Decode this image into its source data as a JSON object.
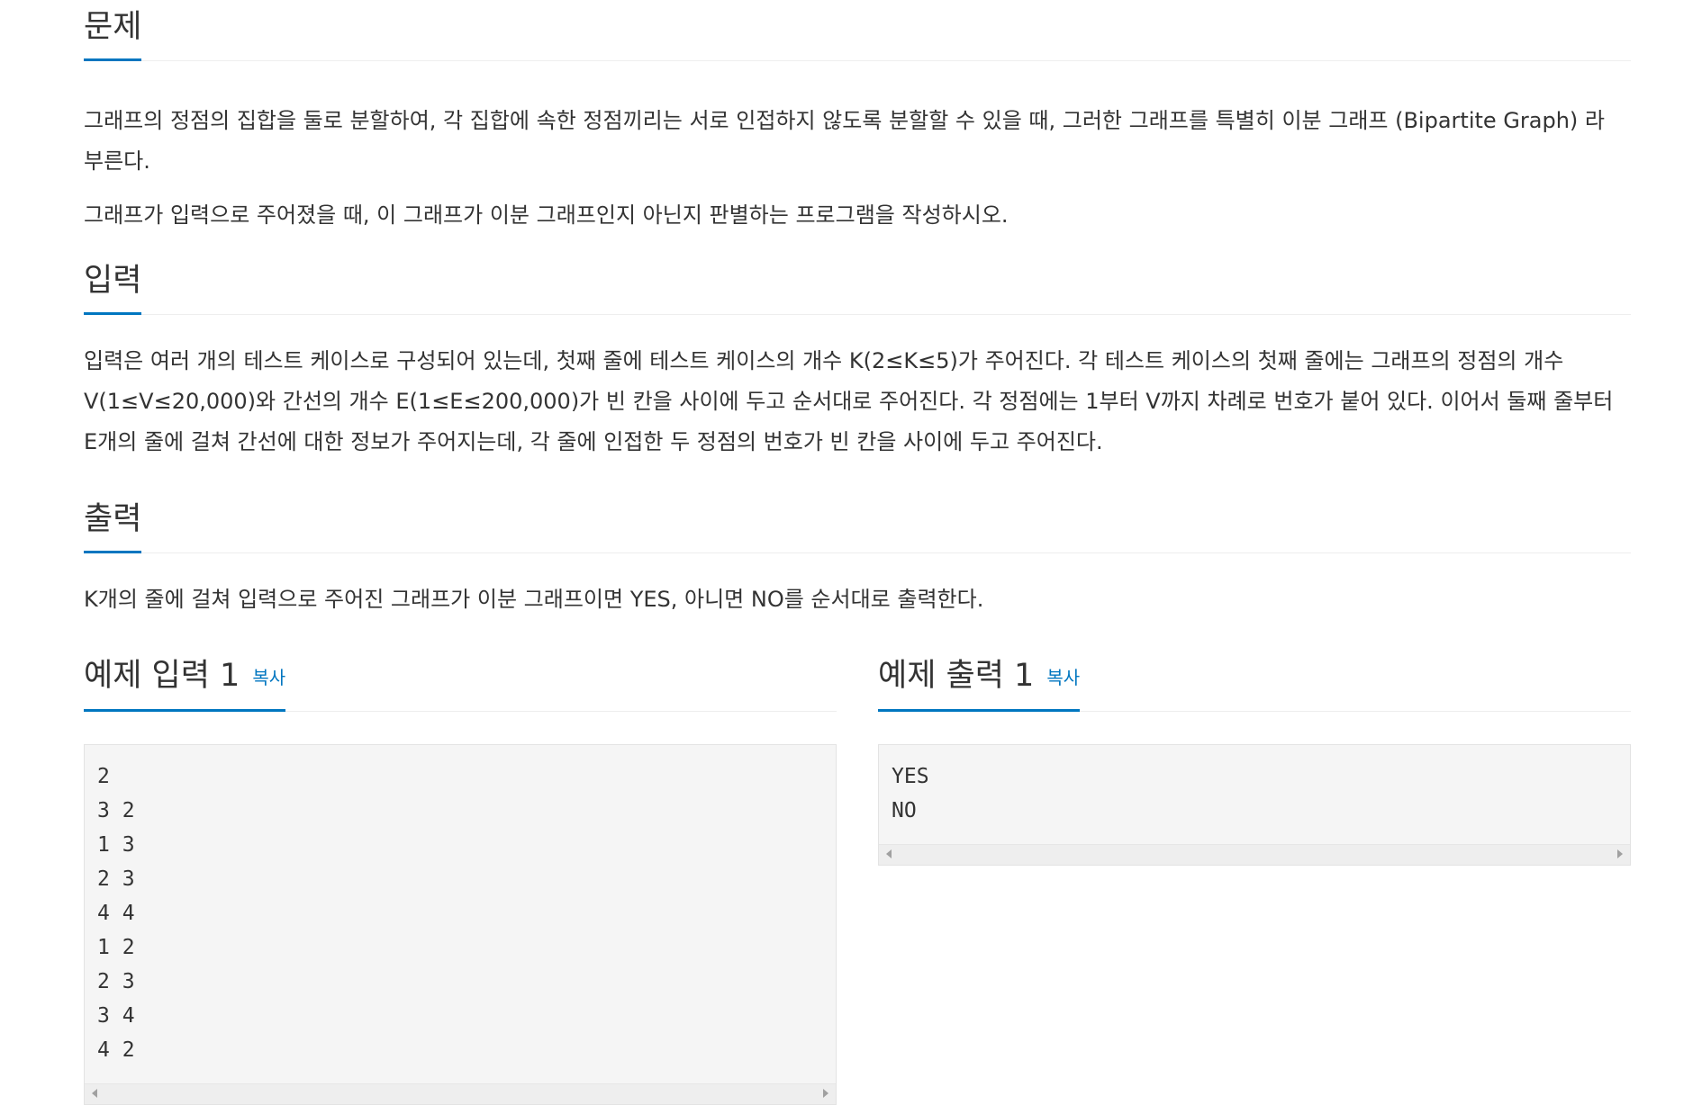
{
  "problem": {
    "title": "문제",
    "paragraphs": [
      "그래프의 정점의 집합을 둘로 분할하여, 각 집합에 속한 정점끼리는 서로 인접하지 않도록 분할할 수 있을 때, 그러한 그래프를 특별히 이분 그래프 (Bipartite Graph) 라 부른다.",
      "그래프가 입력으로 주어졌을 때, 이 그래프가 이분 그래프인지 아닌지 판별하는 프로그램을 작성하시오."
    ]
  },
  "input": {
    "title": "입력",
    "text": "입력은 여러 개의 테스트 케이스로 구성되어 있는데, 첫째 줄에 테스트 케이스의 개수 K(2≤K≤5)가 주어진다. 각 테스트 케이스의 첫째 줄에는 그래프의 정점의 개수 V(1≤V≤20,000)와 간선의 개수 E(1≤E≤200,000)가 빈 칸을 사이에 두고 순서대로 주어진다. 각 정점에는 1부터 V까지 차례로 번호가 붙어 있다. 이어서 둘째 줄부터 E개의 줄에 걸쳐 간선에 대한 정보가 주어지는데, 각 줄에 인접한 두 정점의 번호가 빈 칸을 사이에 두고 주어진다."
  },
  "output": {
    "title": "출력",
    "text": "K개의 줄에 걸쳐 입력으로 주어진 그래프가 이분 그래프이면 YES, 아니면 NO를 순서대로 출력한다."
  },
  "sample_input": {
    "title": "예제 입력 1",
    "copy_label": "복사",
    "lines": "2\n3 2\n1 3\n2 3\n4 4\n1 2\n2 3\n3 4\n4 2"
  },
  "sample_output": {
    "title": "예제 출력 1",
    "copy_label": "복사",
    "lines": "YES\nNO"
  },
  "colors": {
    "accent": "#0076c0",
    "text": "#333333",
    "code_bg": "#f5f5f5"
  }
}
